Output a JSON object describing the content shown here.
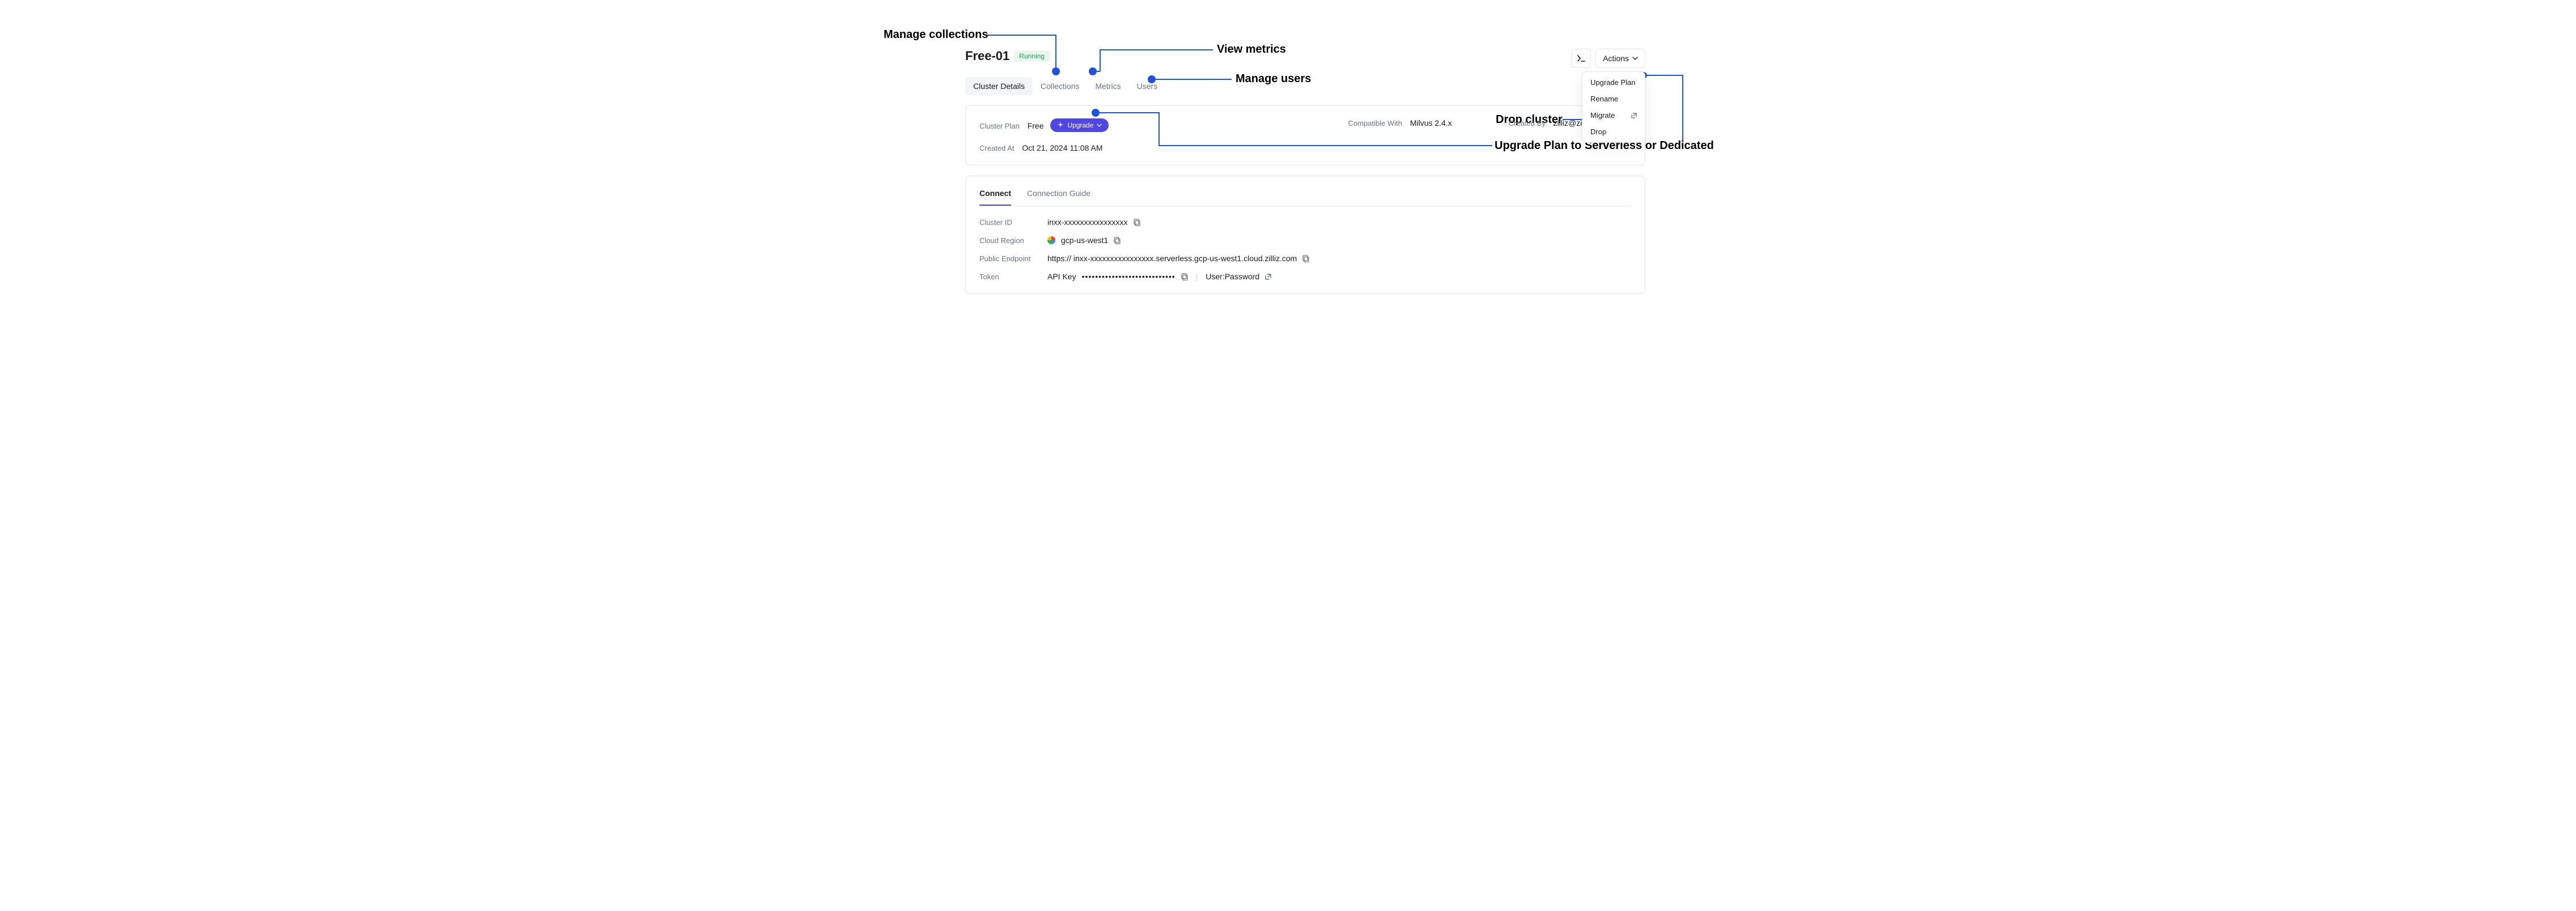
{
  "annotations": {
    "manage_collections": "Manage collections",
    "view_metrics": "View metrics",
    "manage_users": "Manage users",
    "drop_cluster": "Drop cluster",
    "upgrade_plan_long": "Upgrade Plan to Serverless or Dedicated"
  },
  "header": {
    "cluster_name": "Free-01",
    "status": "Running",
    "actions_label": "Actions"
  },
  "actions_menu": {
    "upgrade_plan": "Upgrade Plan",
    "rename": "Rename",
    "migrate": "Migrate",
    "drop": "Drop"
  },
  "tabs": {
    "cluster_details": "Cluster Details",
    "collections": "Collections",
    "metrics": "Metrics",
    "users": "Users"
  },
  "plan_card": {
    "cluster_plan_label": "Cluster Plan",
    "cluster_plan_value": "Free",
    "upgrade_button": "Upgrade",
    "compatible_label": "Compatible With",
    "compatible_value": "Milvus 2.4.x",
    "created_by_label": "Created By",
    "created_by_value": "zilliz@zilliz.com",
    "created_at_label": "Created At",
    "created_at_value": "Oct 21, 2024 11:08 AM"
  },
  "connect_card": {
    "tab_connect": "Connect",
    "tab_guide": "Connection Guide",
    "cluster_id_label": "Cluster ID",
    "cluster_id_value": "inxx-xxxxxxxxxxxxxxxx",
    "cloud_region_label": "Cloud Region",
    "cloud_region_value": "gcp-us-west1",
    "public_endpoint_label": "Public Endpoint",
    "public_endpoint_value": "https:// inxx-xxxxxxxxxxxxxxxx.serverless.gcp-us-west1.cloud.zilliz.com",
    "token_label": "Token",
    "token_api_key": "API Key",
    "token_masked": "••••••••••••••••••••••••••••",
    "token_userpass": "User:Password"
  }
}
